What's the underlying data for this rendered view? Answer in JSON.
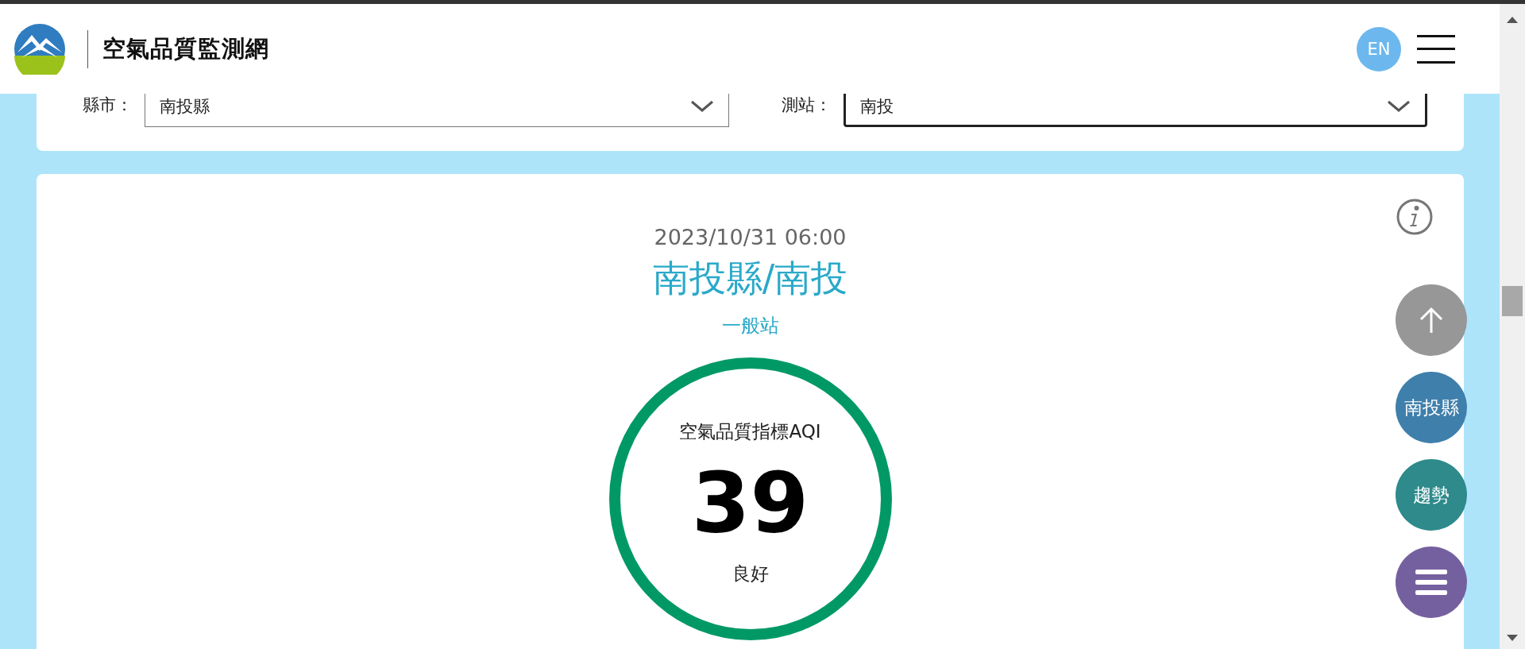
{
  "header": {
    "title": "空氣品質監測網",
    "language_button": "EN"
  },
  "filters": [
    {
      "label": "縣市：",
      "value": "南投縣",
      "focused": false
    },
    {
      "label": "測站：",
      "value": "南投",
      "focused": true
    }
  ],
  "station": {
    "time": "2023/10/31 06:00",
    "name": "南投縣/南投",
    "type": "一般站",
    "aqi_label": "空氣品質指標AQI",
    "aqi": "39",
    "status": "良好",
    "color": "#009966"
  },
  "float_buttons": [
    {
      "kind": "top",
      "color": "#979797"
    },
    {
      "kind": "text",
      "label": "南投縣",
      "color": "#3f7fab"
    },
    {
      "kind": "text",
      "label": "趨勢",
      "color": "#2e8a8b"
    },
    {
      "kind": "menu",
      "color": "#75609f"
    }
  ]
}
